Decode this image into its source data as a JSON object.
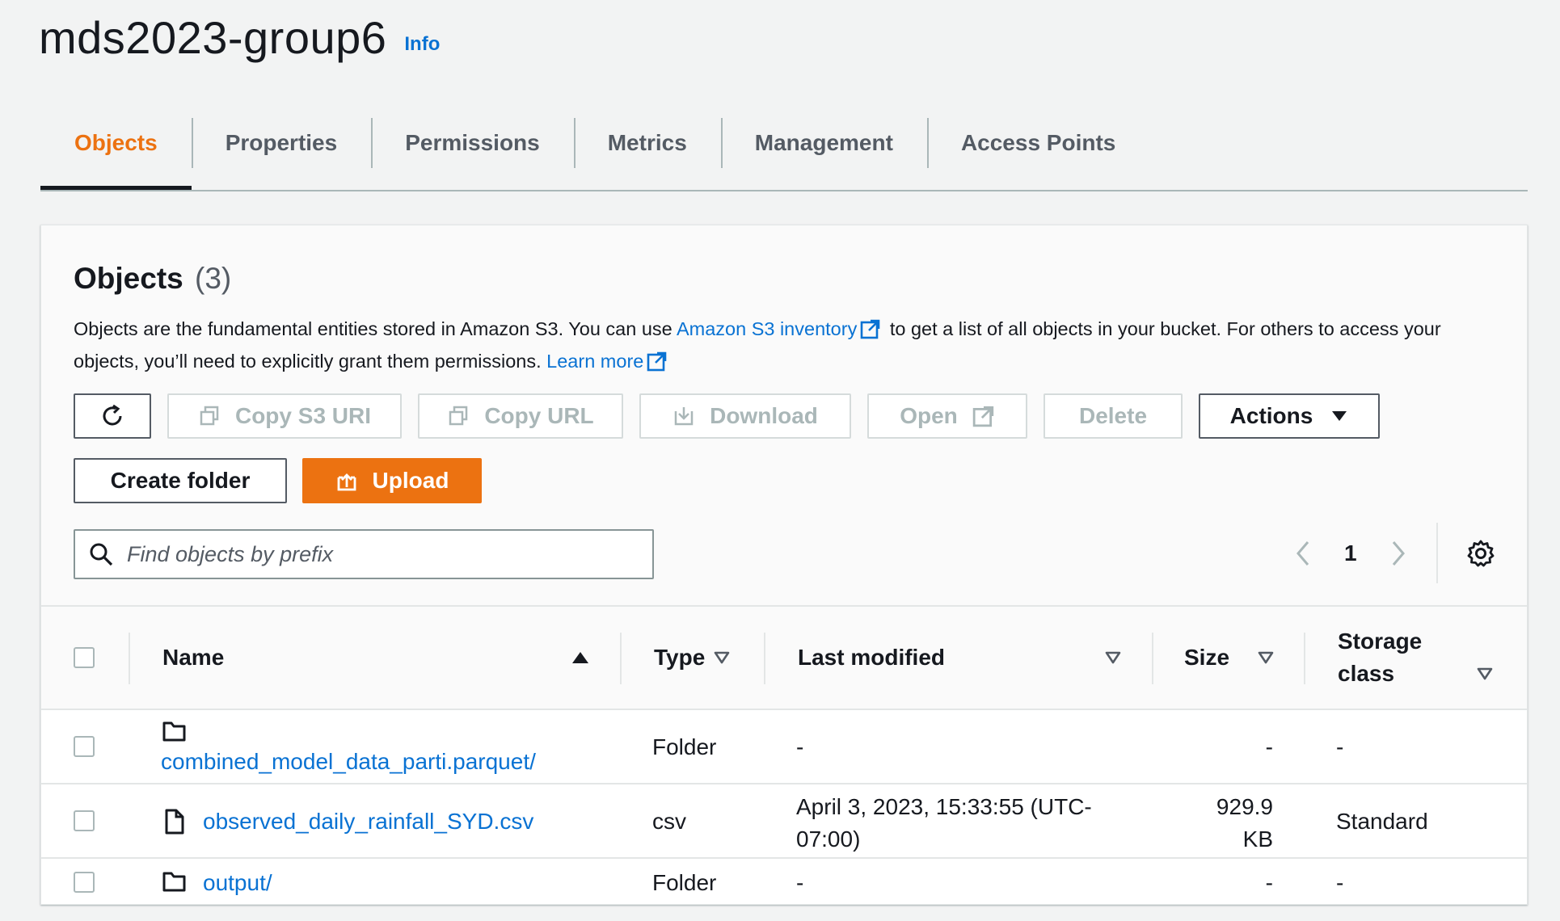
{
  "page": {
    "title": "mds2023-group6",
    "info": "Info"
  },
  "tabs": [
    "Objects",
    "Properties",
    "Permissions",
    "Metrics",
    "Management",
    "Access Points"
  ],
  "objects": {
    "title": "Objects",
    "count": "(3)",
    "desc_part1": "Objects are the fundamental entities stored in Amazon S3. You can use ",
    "inventory_link": "Amazon S3 inventory",
    "desc_part2": " to get a list of all objects in your bucket. For others to access your objects, you’ll need to explicitly grant them permissions. ",
    "learn_more": "Learn more"
  },
  "toolbar": {
    "copy_s3_uri": "Copy S3 URI",
    "copy_url": "Copy URL",
    "download": "Download",
    "open": "Open",
    "delete": "Delete",
    "actions": "Actions",
    "create_folder": "Create folder",
    "upload": "Upload"
  },
  "search": {
    "placeholder": "Find objects by prefix"
  },
  "pagination": {
    "page": "1"
  },
  "table": {
    "headers": {
      "name": "Name",
      "type": "Type",
      "last_modified": "Last modified",
      "size": "Size",
      "storage_class_1": "Storage",
      "storage_class_2": "class"
    },
    "rows": [
      {
        "name": "combined_model_data_parti.parquet/",
        "type": "Folder",
        "last_modified": "-",
        "last_modified_2": "",
        "size": "-",
        "size_2": "",
        "storage_class": "-",
        "icon": "folder-icon"
      },
      {
        "name": "observed_daily_rainfall_SYD.csv",
        "type": "csv",
        "last_modified": "April 3, 2023, 15:33:55 (UTC-",
        "last_modified_2": "07:00)",
        "size": "929.9",
        "size_2": "KB",
        "storage_class": "Standard",
        "icon": "file-icon"
      },
      {
        "name": "output/",
        "type": "Folder",
        "last_modified": "-",
        "last_modified_2": "",
        "size": "-",
        "size_2": "",
        "storage_class": "-",
        "icon": "folder-icon"
      }
    ]
  },
  "colors": {
    "accent": "#ec7211",
    "link": "#0972d3",
    "text": "#16191f"
  }
}
